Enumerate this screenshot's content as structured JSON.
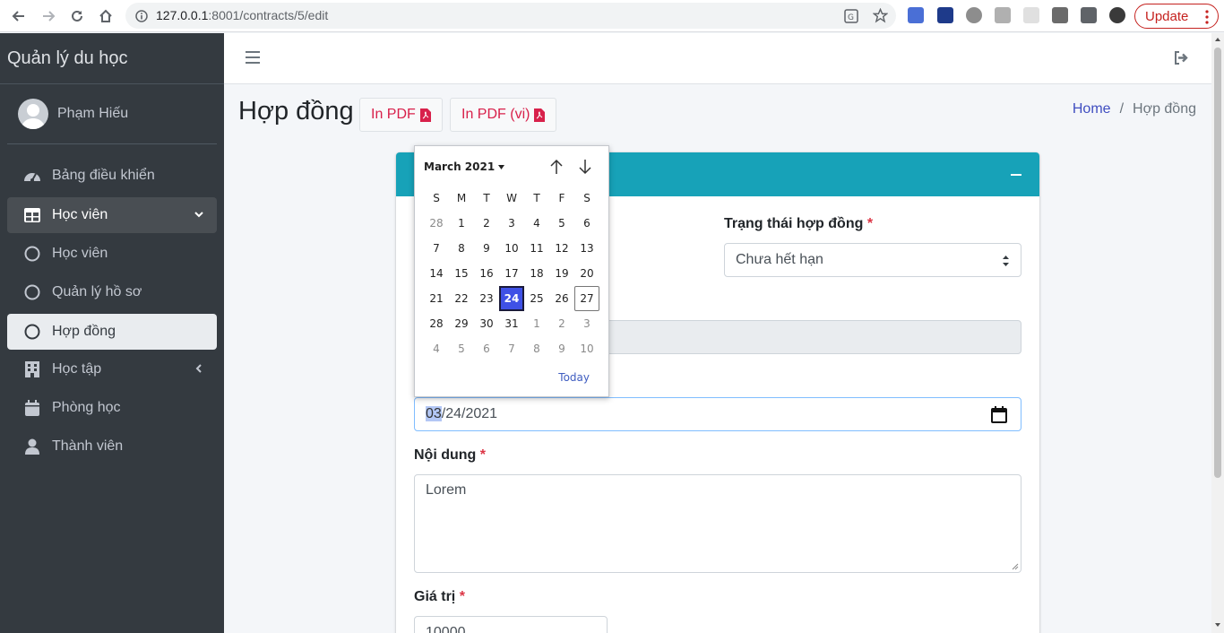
{
  "browser": {
    "url_host": "127.0.0.1",
    "url_rest": ":8001/contracts/5/edit",
    "update_label": "Update"
  },
  "sidebar": {
    "brand": "Quản lý du học",
    "user_name": "Phạm Hiếu",
    "items": [
      {
        "label": "Bảng điều khiển",
        "icon": "tachometer-icon"
      },
      {
        "label": "Học viên",
        "icon": "table-icon"
      },
      {
        "label": "Học viên",
        "icon": "circle-icon"
      },
      {
        "label": "Quản lý hồ sơ",
        "icon": "circle-icon"
      },
      {
        "label": "Hợp đồng",
        "icon": "circle-icon"
      },
      {
        "label": "Học tập",
        "icon": "building-icon"
      },
      {
        "label": "Phòng học",
        "icon": "calendar-icon"
      },
      {
        "label": "Thành viên",
        "icon": "user-icon"
      }
    ]
  },
  "header": {
    "title": "Hợp đồng",
    "pdf_button": "In PDF",
    "pdf_vi_button": "In PDF (vi)",
    "breadcrumb_home": "Home",
    "breadcrumb_sep": "/",
    "breadcrumb_current": "Hợp đồng"
  },
  "form": {
    "status_label": "Trạng thái hợp đồng",
    "status_value": "Chưa hết hạn",
    "date_value_month": "03",
    "date_value_rest": "/24/2021",
    "content_label": "Nội dung",
    "content_value": "Lorem",
    "value_label": "Giá trị",
    "value_value": "10000",
    "required_mark": "*"
  },
  "datepicker": {
    "month_label": "March 2021",
    "weekdays": [
      "S",
      "M",
      "T",
      "W",
      "T",
      "F",
      "S"
    ],
    "weeks": [
      [
        "28",
        "1",
        "2",
        "3",
        "4",
        "5",
        "6"
      ],
      [
        "7",
        "8",
        "9",
        "10",
        "11",
        "12",
        "13"
      ],
      [
        "14",
        "15",
        "16",
        "17",
        "18",
        "19",
        "20"
      ],
      [
        "21",
        "22",
        "23",
        "24",
        "25",
        "26",
        "27"
      ],
      [
        "28",
        "29",
        "30",
        "31",
        "1",
        "2",
        "3"
      ],
      [
        "4",
        "5",
        "6",
        "7",
        "8",
        "9",
        "10"
      ]
    ],
    "selected_day": "24",
    "today_day": "27",
    "today_label": "Today"
  },
  "colors": {
    "sidebar_bg": "#343a40",
    "card_header": "#17a2b8",
    "pdf_text": "#d8214b",
    "selected_day": "#3f51e6"
  }
}
